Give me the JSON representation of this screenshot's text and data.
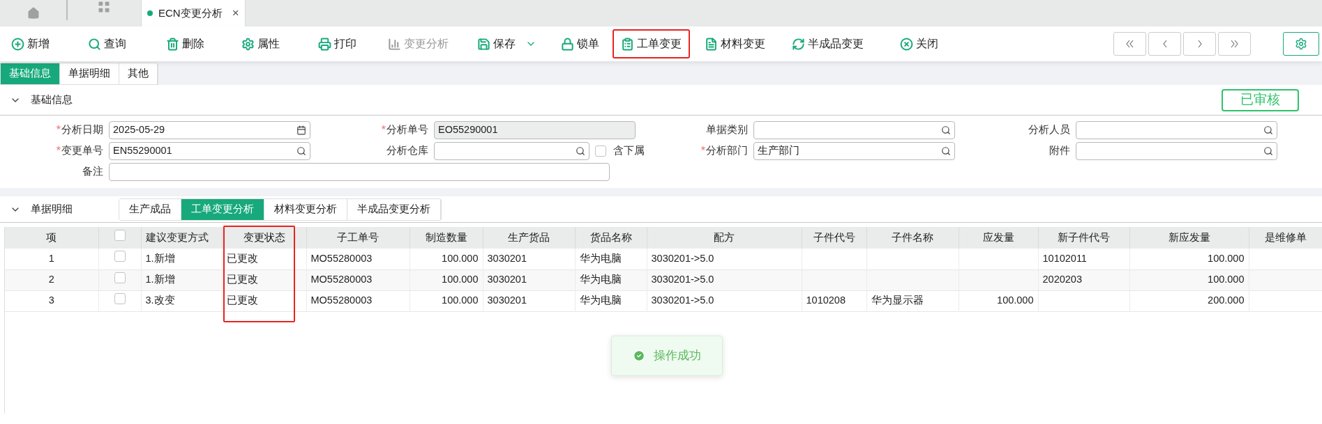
{
  "window_tabs": [
    {
      "kind": "home",
      "selected": false
    },
    {
      "kind": "apps",
      "selected": false
    },
    {
      "kind": "page",
      "label": "ECN变更分析",
      "close": "×",
      "selected": true
    }
  ],
  "toolbar": {
    "items": [
      {
        "label": "新增",
        "disabled": false,
        "dropdown": false,
        "highlighted": false
      },
      {
        "label": "查询",
        "disabled": false,
        "dropdown": false,
        "highlighted": false
      },
      {
        "label": "删除",
        "disabled": false,
        "dropdown": false,
        "highlighted": false
      },
      {
        "label": "属性",
        "disabled": false,
        "dropdown": false,
        "highlighted": false
      },
      {
        "label": "打印",
        "disabled": false,
        "dropdown": false,
        "highlighted": false
      },
      {
        "label": "变更分析",
        "disabled": true,
        "dropdown": false,
        "highlighted": false
      },
      {
        "label": "保存",
        "disabled": false,
        "dropdown": true,
        "highlighted": false
      },
      {
        "label": "锁单",
        "disabled": false,
        "dropdown": false,
        "highlighted": false
      },
      {
        "label": "工单变更",
        "disabled": false,
        "dropdown": false,
        "highlighted": true
      },
      {
        "label": "材料变更",
        "disabled": false,
        "dropdown": false,
        "highlighted": false
      },
      {
        "label": "半成品变更",
        "disabled": false,
        "dropdown": false,
        "highlighted": false
      },
      {
        "label": "关闭",
        "disabled": false,
        "dropdown": false,
        "highlighted": false
      }
    ]
  },
  "form_tabs": [
    {
      "label": "基础信息",
      "selected": true
    },
    {
      "label": "单据明细",
      "selected": false
    },
    {
      "label": "其他",
      "selected": false
    }
  ],
  "basic_info": {
    "title": "基础信息",
    "expanded": true,
    "status_badge": "已审核",
    "fields": [
      {
        "label": "分析日期",
        "required_mark": "*",
        "kind": "date",
        "value": "2025-05-29"
      },
      {
        "label": "分析单号",
        "required_mark": "*",
        "kind": "readonly",
        "value": "EO55290001"
      },
      {
        "label": "单据类别",
        "kind": "lookup"
      },
      {
        "label": "分析人员",
        "kind": "lookup"
      },
      {
        "label": "变更单号",
        "required_mark": "*",
        "kind": "lookup",
        "value": "EN55290001"
      },
      {
        "label": "分析仓库",
        "kind": "lookup",
        "checkbox": {
          "label": "含下属",
          "checked": false
        }
      },
      {
        "label": "分析部门",
        "required_mark": "*",
        "kind": "lookup",
        "value": "生产部门"
      },
      {
        "label": "附件",
        "kind": "lookup"
      },
      {
        "label": "备注",
        "kind": "memo"
      }
    ]
  },
  "detail": {
    "title": "单据明细",
    "expanded": true,
    "tabs": [
      {
        "label": "生产成品",
        "selected": false
      },
      {
        "label": "工单变更分析",
        "selected": true
      },
      {
        "label": "材料变更分析",
        "selected": false
      },
      {
        "label": "半成品变更分析",
        "selected": false
      }
    ],
    "table": {
      "columns": [
        {
          "kind": "text",
          "label": "项",
          "highlighted": false
        },
        {
          "kind": "checkbox",
          "checked": false,
          "highlighted": false
        },
        {
          "kind": "text",
          "label": "建议变更方式",
          "highlighted": false
        },
        {
          "kind": "text",
          "label": "变更状态",
          "highlighted": true
        },
        {
          "kind": "text",
          "label": "子工单号",
          "highlighted": false
        },
        {
          "kind": "text",
          "label": "制造数量",
          "highlighted": false
        },
        {
          "kind": "text",
          "label": "生产货品",
          "highlighted": false
        },
        {
          "kind": "text",
          "label": "货品名称",
          "highlighted": false
        },
        {
          "kind": "text",
          "label": "配方",
          "highlighted": false
        },
        {
          "kind": "text",
          "label": "子件代号",
          "highlighted": false
        },
        {
          "kind": "text",
          "label": "子件名称",
          "highlighted": false
        },
        {
          "kind": "text",
          "label": "应发量",
          "highlighted": false
        },
        {
          "kind": "text",
          "label": "新子件代号",
          "highlighted": false
        },
        {
          "kind": "text",
          "label": "新应发量",
          "highlighted": false
        },
        {
          "kind": "text",
          "label": "是维修单",
          "highlighted": false
        }
      ],
      "rows": [
        {
          "checked": false,
          "cells": [
            "1",
            null,
            "1.新增",
            "已更改",
            "MO55280003",
            "100.000",
            "3030201",
            "华为电脑",
            "3030201->5.0",
            null,
            null,
            null,
            "10102011",
            "100.000",
            null
          ]
        },
        {
          "checked": false,
          "cells": [
            "2",
            null,
            "1.新增",
            "已更改",
            "MO55280003",
            "100.000",
            "3030201",
            "华为电脑",
            "3030201->5.0",
            null,
            null,
            null,
            "2020203",
            "100.000",
            null
          ]
        },
        {
          "checked": false,
          "cells": [
            "3",
            null,
            "3.改变",
            "已更改",
            "MO55280003",
            "100.000",
            "3030201",
            "华为电脑",
            "3030201->5.0",
            "1010208",
            "华为显示器",
            "100.000",
            null,
            "200.000",
            null
          ]
        }
      ]
    }
  },
  "toast": {
    "kind": "success",
    "text": "操作成功"
  }
}
